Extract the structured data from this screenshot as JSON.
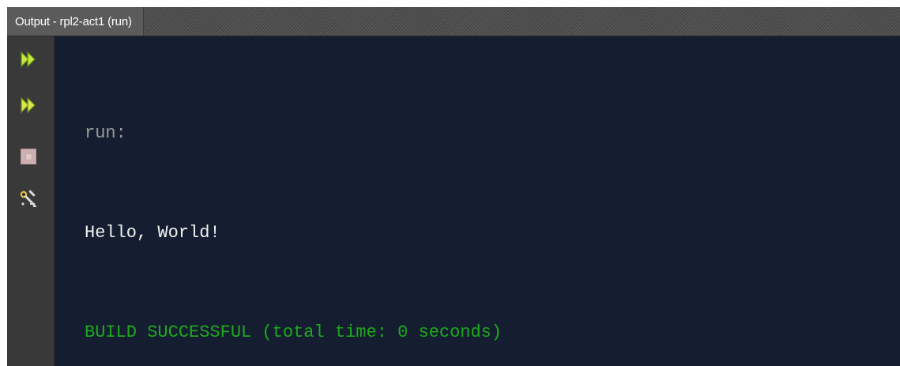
{
  "panel": {
    "tab_title": "Output - rpl2-act1 (run)"
  },
  "toolbar": {
    "items": [
      {
        "name": "rerun",
        "icon": "double-play-icon"
      },
      {
        "name": "rerun-with-parameters",
        "icon": "double-play-icon"
      },
      {
        "name": "stop",
        "icon": "stop-icon"
      },
      {
        "name": "settings",
        "icon": "wrench-settings-icon"
      }
    ]
  },
  "console": {
    "lines": [
      {
        "text": "run:",
        "kind": "info"
      },
      {
        "text": "Hello, World!",
        "kind": "output"
      },
      {
        "text": "BUILD SUCCESSFUL (total time: 0 seconds)",
        "kind": "success"
      }
    ]
  },
  "colors": {
    "console_background": "#141e30",
    "info_text": "#9a9a9a",
    "output_text": "#f2f2f2",
    "success_text": "#1ea91e",
    "play_icon": "#c8e63c"
  }
}
